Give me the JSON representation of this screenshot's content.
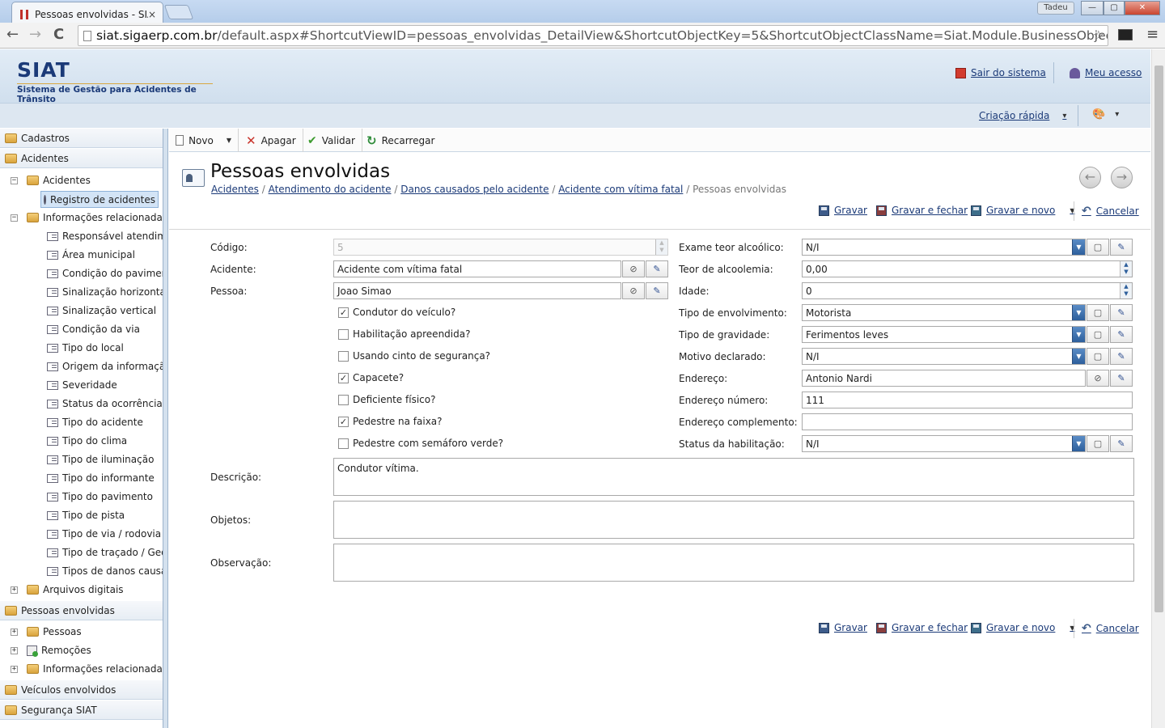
{
  "browser": {
    "tab_title": "Pessoas envolvidas - SIAT",
    "tab_close": "×",
    "user": "Tadeu",
    "min": "—",
    "max": "▢",
    "close": "✕",
    "back": "←",
    "forward": "→",
    "reload": "C",
    "url_host": "siat.sigaerp.com.br",
    "url_path": "/default.aspx#ShortcutViewID=pessoas_envolvidas_DetailView&ShortcutObjectKey=5&ShortcutObjectClassName=Siat.Module.BusinessObjects.siat.pessoas",
    "star": "☆",
    "menu": "≡"
  },
  "header": {
    "logo": "SIAT",
    "subtitle": "Sistema de Gestão para Acidentes de Trânsito",
    "logout": "Sair do sistema",
    "my_access": "Meu acesso",
    "quick_create": "Criação rápida",
    "dropdown": "▾",
    "palette_icon": "🎨"
  },
  "sidebar": {
    "cadastros": "Cadastros",
    "acidentes": "Acidentes",
    "acidentes_sub": "Acidentes",
    "registro": "Registro de acidentes",
    "informacoes": "Informações relacionadas",
    "info_items": [
      "Responsável atendimento",
      "Área municipal",
      "Condição do pavimento",
      "Sinalização horizontal",
      "Sinalização vertical",
      "Condição da via",
      "Tipo do local",
      "Origem da informação",
      "Severidade",
      "Status da ocorrência",
      "Tipo do acidente",
      "Tipo do clima",
      "Tipo de iluminação",
      "Tipo do informante",
      "Tipo do pavimento",
      "Tipo de pista",
      "Tipo de via / rodovia",
      "Tipo de traçado / Geometria",
      "Tipos de danos causados"
    ],
    "arquivos": "Arquivos digitais",
    "pessoas_envolvidas": "Pessoas envolvidas",
    "pessoas": "Pessoas",
    "remocoes": "Remoções",
    "informacoes2": "Informações relacionadas",
    "veiculos": "Veículos envolvidos",
    "seguranca": "Segurança SIAT",
    "minus": "−",
    "plus": "+"
  },
  "actions": {
    "novo": "Novo",
    "apagar": "Apagar",
    "validar": "Validar",
    "recarregar": "Recarregar",
    "x": "✕",
    "check": "✔",
    "reload": "↻",
    "caret": "▼"
  },
  "page": {
    "title": "Pessoas envolvidas",
    "breadcrumb": [
      "Acidentes",
      "Atendimento do acidente",
      "Danos causados pelo acidente",
      "Acidente com vítima fatal"
    ],
    "breadcrumb_current": "Pessoas envolvidas",
    "sep": "/",
    "prev": "←",
    "next": "→"
  },
  "save": {
    "gravar": "Gravar",
    "gravar_fechar": "Gravar e fechar",
    "gravar_novo": "Gravar e novo",
    "cancelar": "Cancelar",
    "undo": "↶"
  },
  "form": {
    "codigo_label": "Código:",
    "codigo": "5",
    "acidente_label": "Acidente:",
    "acidente": "Acidente com vítima fatal",
    "pessoa_label": "Pessoa:",
    "pessoa": "Joao Simao",
    "checks": [
      {
        "label": "Condutor do veículo?",
        "mark": "✓"
      },
      {
        "label": "Habilitação apreendida?",
        "mark": ""
      },
      {
        "label": "Usando cinto de segurança?",
        "mark": ""
      },
      {
        "label": "Capacete?",
        "mark": "✓"
      },
      {
        "label": "Deficiente físico?",
        "mark": ""
      },
      {
        "label": "Pedestre na faixa?",
        "mark": "✓"
      },
      {
        "label": "Pedestre com semáforo verde?",
        "mark": ""
      }
    ],
    "exame_label": "Exame teor alcoólico:",
    "exame": "N/I",
    "teor_label": "Teor de alcoolemia:",
    "teor": "0,00",
    "idade_label": "Idade:",
    "idade": "0",
    "tipo_env_label": "Tipo de envolvimento:",
    "tipo_env": "Motorista",
    "tipo_grav_label": "Tipo de gravidade:",
    "tipo_grav": "Ferimentos leves",
    "motivo_label": "Motivo declarado:",
    "motivo": "N/I",
    "endereco_label": "Endereço:",
    "endereco": "Antonio Nardi",
    "end_num_label": "Endereço número:",
    "end_num": "111",
    "end_comp_label": "Endereço complemento:",
    "end_comp": "",
    "status_hab_label": "Status da habilitação:",
    "status_hab": "N/I",
    "descricao_label": "Descrição:",
    "descricao": "Condutor vítima.",
    "objetos_label": "Objetos:",
    "objetos": "",
    "observacao_label": "Observação:",
    "observacao": "",
    "dd_arrow": "▼",
    "spin_up": "▲",
    "spin_down": "▼",
    "btn_new": "▢",
    "btn_edit": "✎",
    "btn_find": "⊘"
  }
}
